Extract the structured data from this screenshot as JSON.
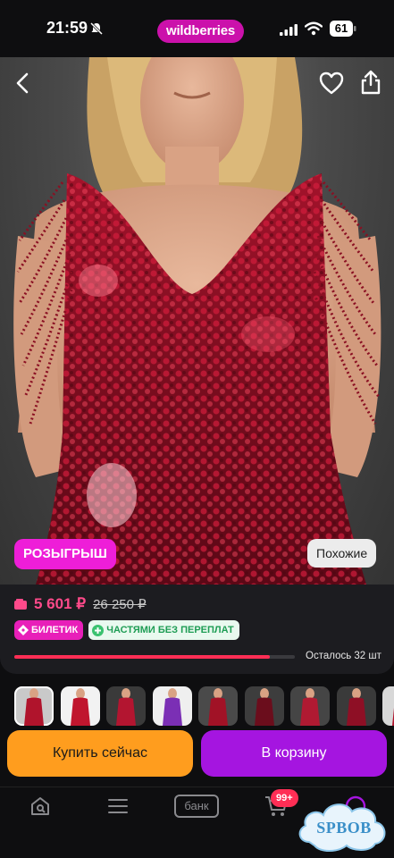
{
  "status_bar": {
    "time": "21:59",
    "brand": "wildberries",
    "battery": "61"
  },
  "product": {
    "promo_badge": "РОЗЫГРЫШ",
    "similar_label": "Похожие",
    "price": "5 601 ₽",
    "old_price": "26 250 ₽",
    "tags": [
      {
        "label": "БИЛЕТИК",
        "icon": "ticket-icon"
      },
      {
        "label": "ЧАСТЯМИ БЕЗ ПЕРЕПЛАТ",
        "icon": "plus-icon"
      }
    ],
    "stock_label": "Осталось 32 шт",
    "stock_fraction": 0.91,
    "thumbnail_count": 9
  },
  "actions": {
    "buy_now": "Купить сейчас",
    "add_to_cart": "В корзину"
  },
  "bottom_nav": {
    "items": [
      {
        "name": "home",
        "icon": "search-home-icon"
      },
      {
        "name": "catalog",
        "icon": "menu-icon"
      },
      {
        "name": "bank",
        "label": "банк"
      },
      {
        "name": "cart",
        "icon": "cart-icon",
        "badge": "99+"
      },
      {
        "name": "profile",
        "icon": "profile-icon"
      }
    ]
  },
  "watermark": {
    "text": "SPBOB"
  },
  "colors": {
    "brand": "#cb11ab",
    "price": "#ff4a8a",
    "buy_now": "#ff9d1e",
    "add_to_cart": "#a515e0",
    "promo": "#ee1ed8",
    "progress": "#ff2e55"
  }
}
